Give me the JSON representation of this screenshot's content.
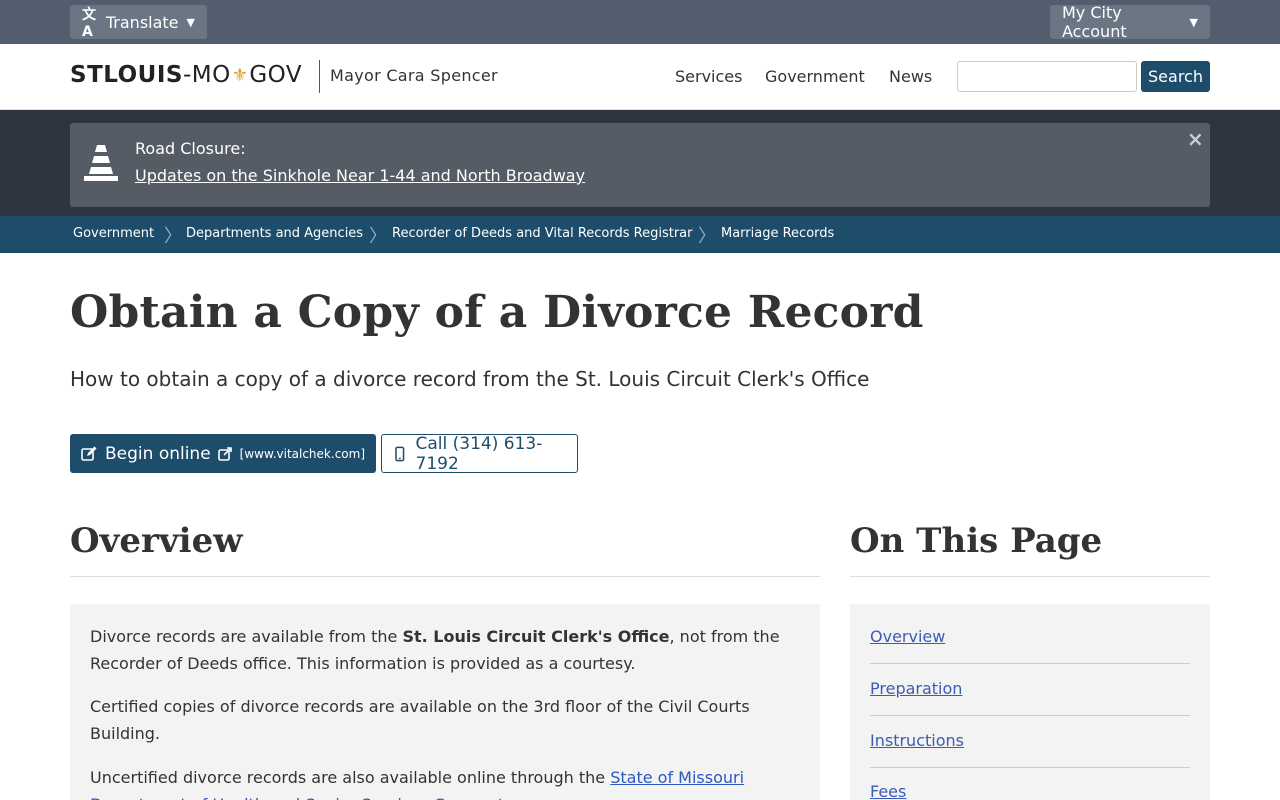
{
  "topbar": {
    "translate_label": "Translate",
    "account_label": "My City Account"
  },
  "header": {
    "logo_part1": "STLOUIS",
    "logo_dash": "-",
    "logo_part2": "MO",
    "logo_part3": "GOV",
    "mayor": "Mayor Cara Spencer",
    "nav": [
      "Services",
      "Government",
      "News"
    ],
    "search_placeholder": "",
    "search_button": "Search"
  },
  "alert": {
    "title": "Road Closure:",
    "link": "Updates on the Sinkhole Near 1-44 and North Broadway",
    "close": "×"
  },
  "breadcrumb": [
    "Government",
    "Departments and Agencies",
    "Recorder of Deeds and Vital Records Registrar",
    "Marriage Records"
  ],
  "page": {
    "title": "Obtain a Copy of a Divorce Record",
    "subtitle": "How to obtain a copy of a divorce record from the St. Louis Circuit Clerk's Office"
  },
  "actions": {
    "online_label": "Begin online",
    "online_url": "[www.vitalchek.com]",
    "call_label": "Call (314) 613-7192"
  },
  "overview": {
    "heading": "Overview",
    "p1_a": "Divorce records are available from the ",
    "p1_b": "St. Louis Circuit Clerk's Office",
    "p1_c": ", not from the Recorder of Deeds office. This information is provided as a courtesy.",
    "p2": "Certified copies of divorce records are available on the 3rd floor of the Civil Courts Building.",
    "p3_a": "Uncertified divorce records are also available online through the ",
    "p3_link": "State of Missouri Department of Health and Senior Services Case.net"
  },
  "on_this_page": {
    "heading": "On This Page",
    "items": [
      "Overview",
      "Preparation",
      "Instructions",
      "Fees"
    ]
  },
  "colors": {
    "topbar": "#525e6e",
    "brand": "#1d4d6b",
    "alert_bg": "#555c66",
    "link": "#2b59c3"
  }
}
